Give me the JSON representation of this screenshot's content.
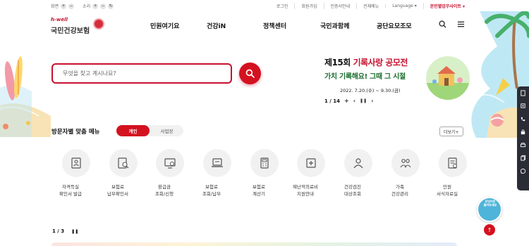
{
  "utility": {
    "font_label": "화면",
    "sound_label": "소리",
    "plus": "+",
    "minus": "−",
    "reset": "↻",
    "links": [
      "로그인",
      "회원가입",
      "인증서안내",
      "전체메뉴",
      "Language ▾"
    ],
    "biz_site": "본인별업무사이트 ▾"
  },
  "logo": {
    "brand": "h-well",
    "name": "국민건강보험"
  },
  "gnb": [
    "민원여기요",
    "건강iN",
    "정책센터",
    "국민과함께",
    "공단요모조모"
  ],
  "icons": {
    "search": "search-icon",
    "menu": "hamburger-icon"
  },
  "search": {
    "placeholder": "무엇을 찾고 계시나요?"
  },
  "banner": {
    "title_prefix": "제15회 ",
    "title_main": "기록사랑 공모전",
    "subtitle": "가치 기록해요! 그때 그 시절",
    "date": "2022. 7.20.(수) ~ 9.30.(금)"
  },
  "banner_pager": {
    "current": "1 / 14",
    "plus": "+",
    "prev": "‹",
    "pause": "❚❚",
    "next": "›"
  },
  "visitor_menu": {
    "title": "방문자별 맞춤 메뉴",
    "tab_personal": "개인",
    "tab_business": "사업장",
    "more": "더보기+",
    "items": [
      {
        "label": "자격득실\n확인서 발급",
        "icon": "document-person-icon"
      },
      {
        "label": "보험료\n납부확인서",
        "icon": "document-search-icon"
      },
      {
        "label": "환급금\n조회/신청",
        "icon": "monitor-refund-icon"
      },
      {
        "label": "보험료\n조회/납부",
        "icon": "laptop-payment-icon"
      },
      {
        "label": "보험료\n계산기",
        "icon": "calculator-icon"
      },
      {
        "label": "재난적의료비\n지원안내",
        "icon": "medical-support-icon"
      },
      {
        "label": "건강검진\n대상조회",
        "icon": "health-check-icon"
      },
      {
        "label": "가족\n건강관리",
        "icon": "family-icon"
      },
      {
        "label": "민원\n서식자료실",
        "icon": "form-archive-icon"
      }
    ]
  },
  "menu_pager": {
    "current": "1 / 3",
    "pause": "❚❚"
  },
  "quick_bar": [
    "document-icon",
    "mobile-icon",
    "phone-icon",
    "lock-icon",
    "printer-icon",
    "copy-icon",
    "chat-icon"
  ],
  "chat_mascot": {
    "label": "무엇이든\n물어보세요"
  },
  "top_button": "↑",
  "colors": {
    "accent": "#d4111f",
    "dark": "#2a2d35"
  }
}
